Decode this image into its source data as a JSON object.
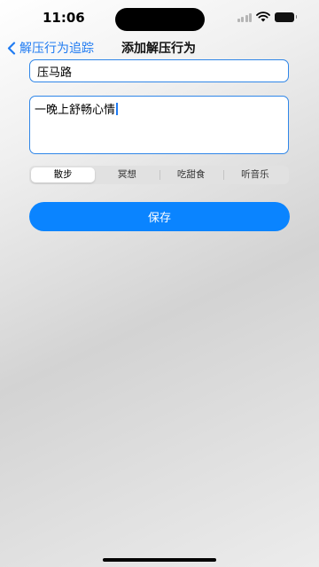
{
  "status_bar": {
    "time": "11:06"
  },
  "nav": {
    "back_label": "解压行为追踪",
    "title": "添加解压行为"
  },
  "form": {
    "name_value": "压马路",
    "description_value": "一晚上舒畅心情"
  },
  "segments": {
    "options": [
      "散步",
      "冥想",
      "吃甜食",
      "听音乐"
    ],
    "selected": "散步"
  },
  "save_label": "保存",
  "colors": {
    "accent": "#0a84ff",
    "field_border": "#2f86e8"
  },
  "icons": [
    "back-chevron-icon",
    "cellular-signal-icon",
    "wifi-icon",
    "battery-icon"
  ]
}
